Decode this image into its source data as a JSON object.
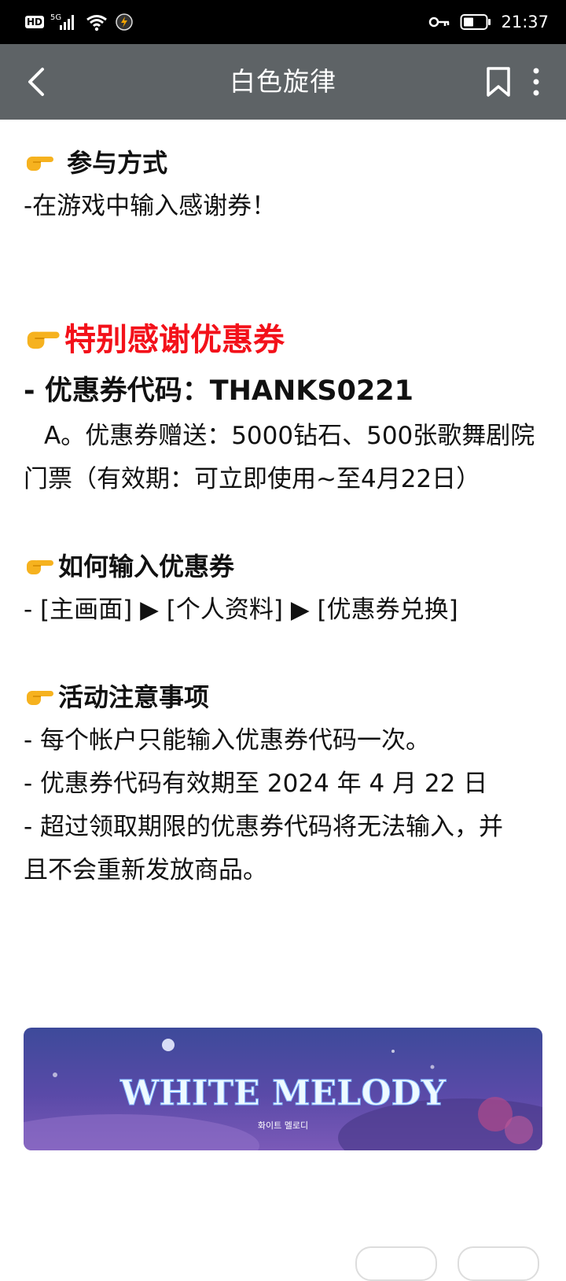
{
  "status_bar": {
    "hd": "HD",
    "network": "5G",
    "time": "21:37",
    "icons": [
      "hd-icon",
      "signal-icon",
      "wifi-icon",
      "charging-icon",
      "key-icon",
      "battery-icon"
    ]
  },
  "app_bar": {
    "title": "白色旋律",
    "icons": [
      "back-arrow-icon",
      "bookmark-icon",
      "more-vertical-icon"
    ]
  },
  "article": {
    "section1_heading": "参与方式",
    "section1_text": "-在游戏中输入感谢券！",
    "section2_heading": "特别感谢优惠券",
    "coupon_line": "- 优惠券代码：THANKS0221",
    "coupon_desc": "A。优惠券赠送：5000钻石、500张歌舞剧院门票（有效期：可立即使用~至4月22日）",
    "section3_heading": "如何输入优惠券",
    "how_to": "- [主画面] ▶ [个人资料] ▶ [优惠券兑换]",
    "section4_heading": "活动注意事项",
    "notes": [
      "- 每个帐户只能输入优惠券代码一次。",
      "- 优惠券代码有效期至 2024 年 4 月 22 日",
      "- 超过领取期限的优惠券代码将无法输入，并且不会重新发放商品。"
    ]
  },
  "banner": {
    "logo_text": "WHITE MELODY",
    "logo_subtext": "화이트 멜로디"
  },
  "colors": {
    "app_bar_bg": "#5e6366",
    "highlight_red": "#f3111a",
    "finger_emoji": "#f6b21f"
  }
}
